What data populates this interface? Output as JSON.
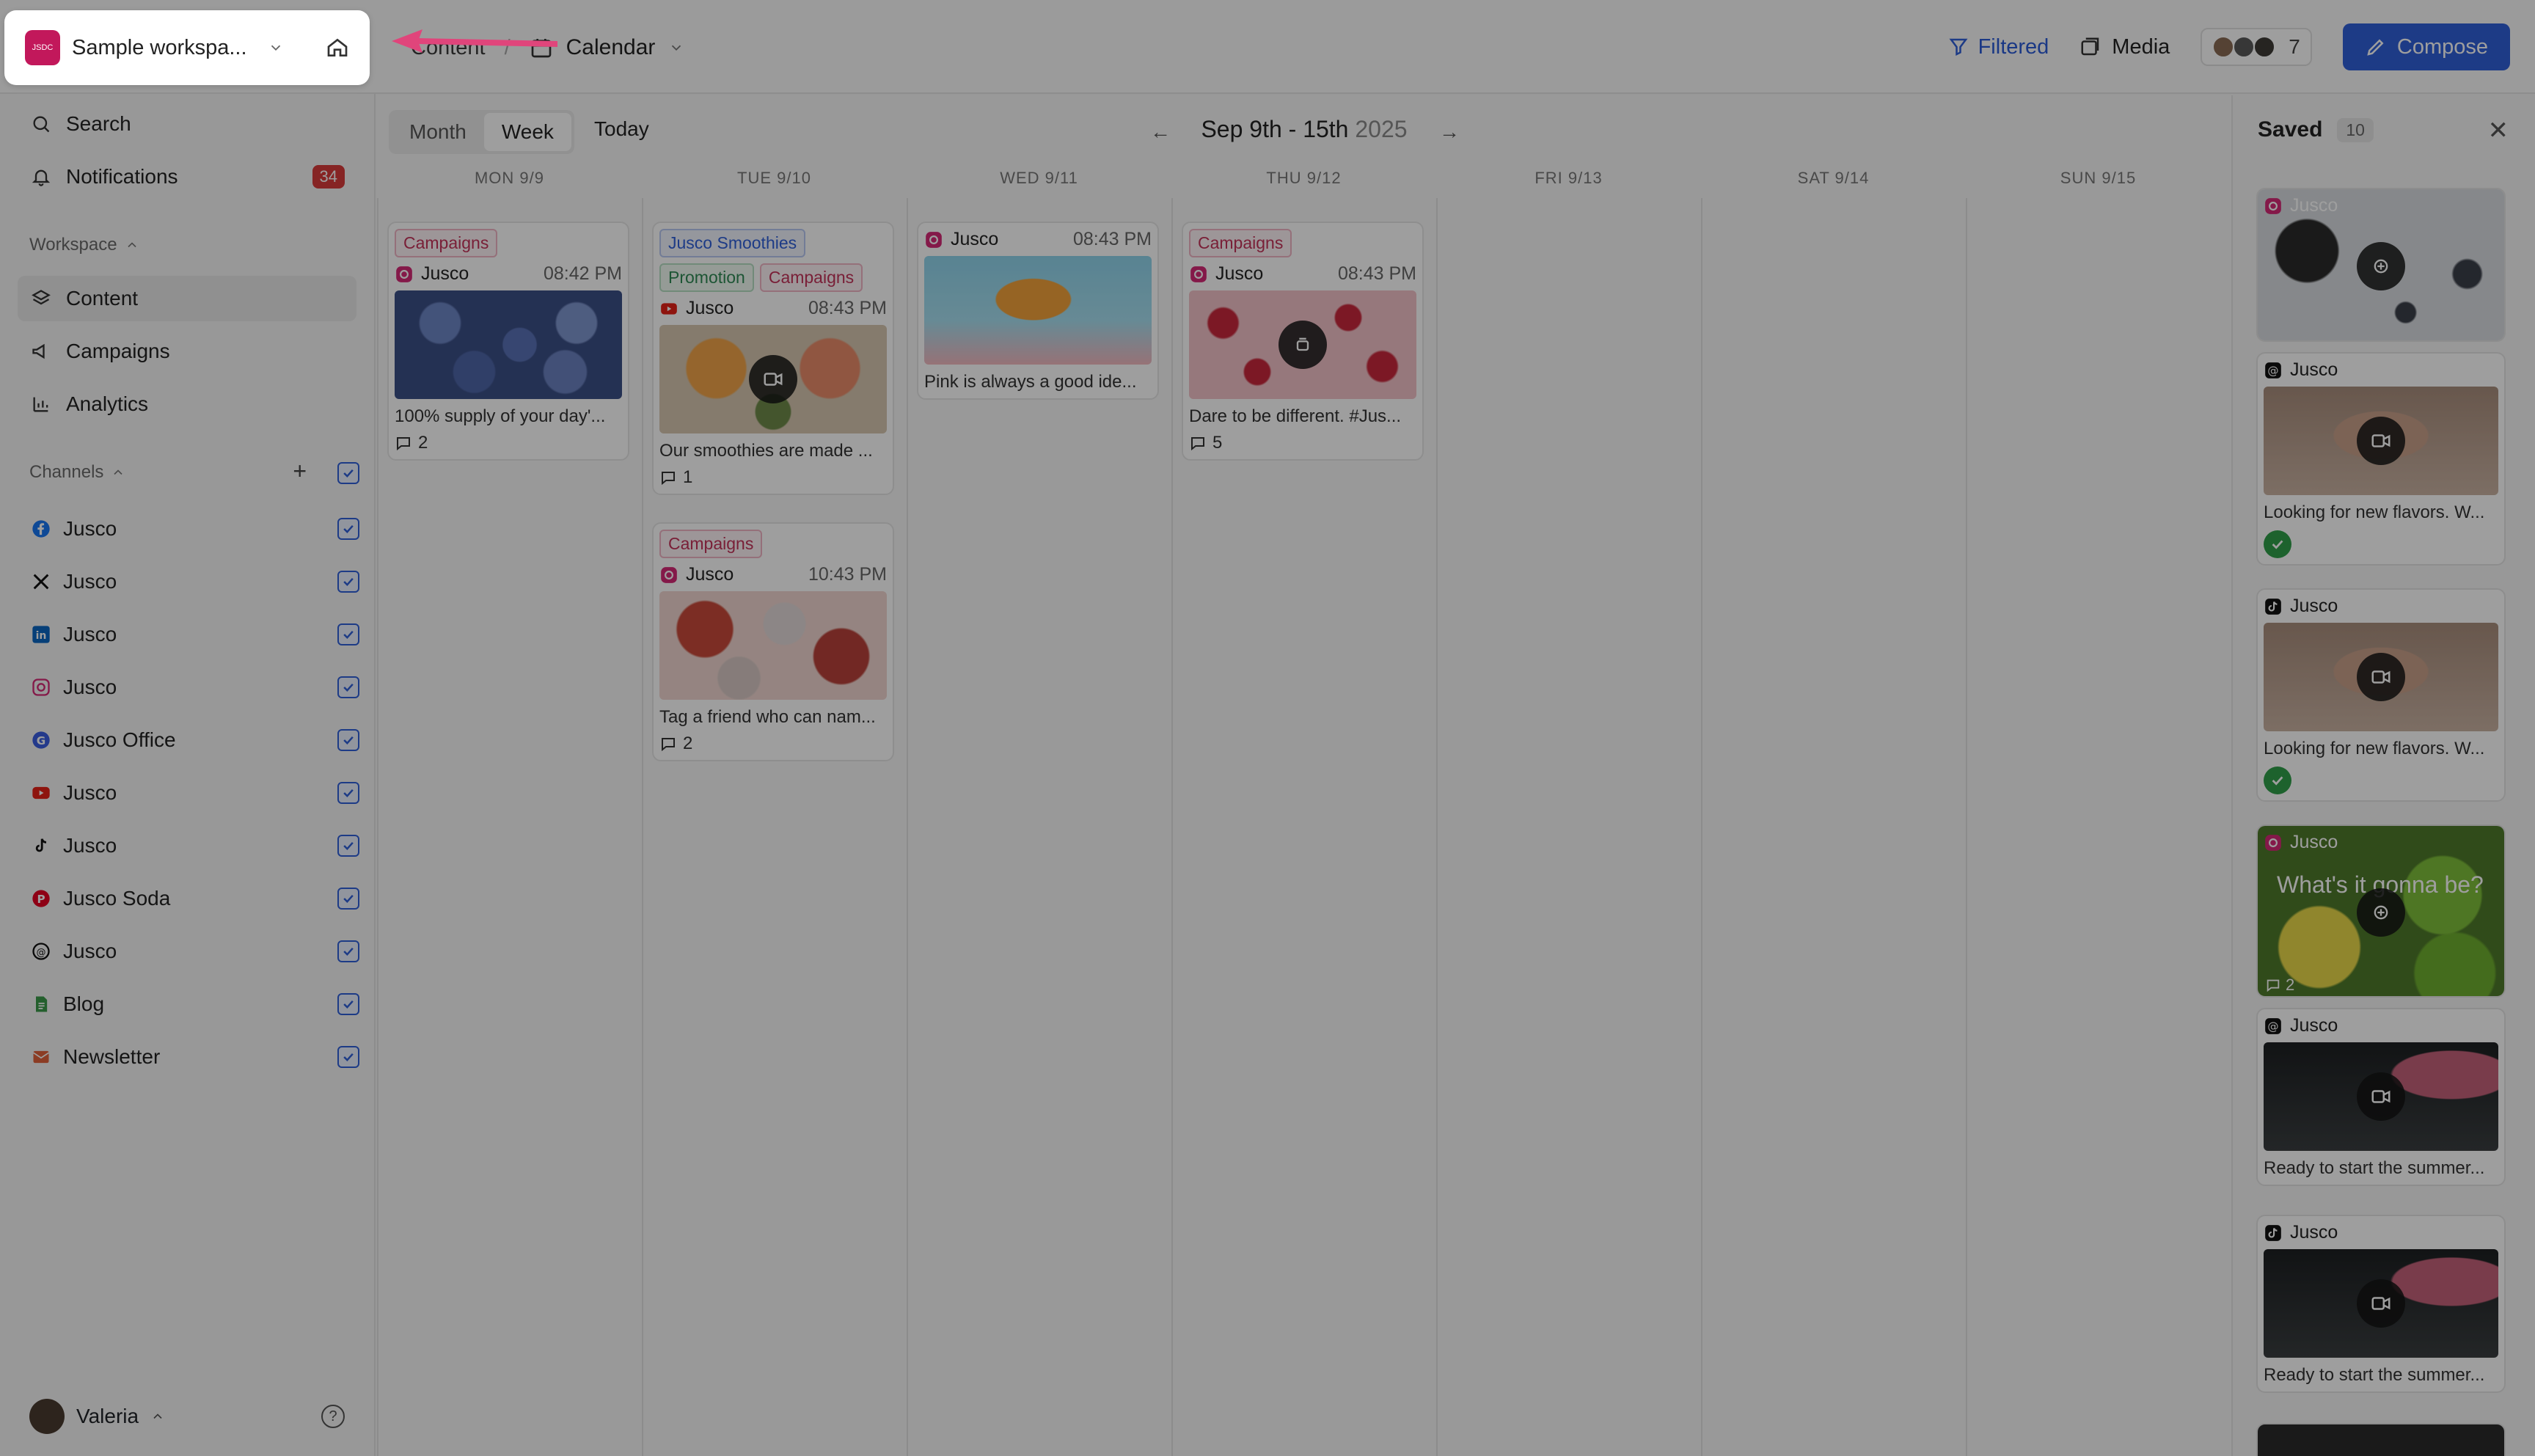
{
  "workspace": {
    "logo_text": "JSDC",
    "name": "Sample workspa..."
  },
  "breadcrumb": {
    "content": "Content",
    "separator": "/",
    "calendar": "Calendar"
  },
  "topbar": {
    "filtered": "Filtered",
    "media": "Media",
    "members_count": "7",
    "compose": "Compose"
  },
  "sidebar": {
    "search": "Search",
    "notifications": "Notifications",
    "notifications_count": "34",
    "workspace_header": "Workspace",
    "content": "Content",
    "campaigns": "Campaigns",
    "analytics": "Analytics",
    "channels_header": "Channels",
    "channels": [
      {
        "icon": "facebook-icon",
        "label": "Jusco"
      },
      {
        "icon": "x-icon",
        "label": "Jusco"
      },
      {
        "icon": "linkedin-icon",
        "label": "Jusco"
      },
      {
        "icon": "instagram-icon",
        "label": "Jusco"
      },
      {
        "icon": "google-icon",
        "label": "Jusco Office"
      },
      {
        "icon": "youtube-icon",
        "label": "Jusco"
      },
      {
        "icon": "tiktok-icon",
        "label": "Jusco"
      },
      {
        "icon": "pinterest-icon",
        "label": "Jusco Soda"
      },
      {
        "icon": "threads-icon",
        "label": "Jusco"
      },
      {
        "icon": "blog-icon",
        "label": "Blog"
      },
      {
        "icon": "newsletter-icon",
        "label": "Newsletter"
      }
    ],
    "user": "Valeria"
  },
  "calendar": {
    "view_month": "Month",
    "view_week": "Week",
    "today": "Today",
    "range": "Sep 9th - 15th",
    "range_year": "2025",
    "days": [
      "MON 9/9",
      "TUE 9/10",
      "WED 9/11",
      "THU 9/12",
      "FRI 9/13",
      "SAT 9/14",
      "SUN 9/15"
    ],
    "posts": {
      "mon1": {
        "tag": "Campaigns",
        "account": "Jusco",
        "time": "08:42 PM",
        "caption": "100% supply of your day'...",
        "comments": "2"
      },
      "tue1": {
        "tag1": "Jusco Smoothies",
        "tag2": "Promotion",
        "tag3": "Campaigns",
        "account": "Jusco",
        "time": "08:43 PM",
        "caption": "Our smoothies are made ...",
        "comments": "1"
      },
      "tue2": {
        "tag": "Campaigns",
        "account": "Jusco",
        "time": "10:43 PM",
        "caption": "Tag a friend who can nam...",
        "comments": "2"
      },
      "wed1": {
        "account": "Jusco",
        "time": "08:43 PM",
        "caption": "Pink is always a good ide..."
      },
      "thu1": {
        "tag": "Campaigns",
        "account": "Jusco",
        "time": "08:43 PM",
        "caption": "Dare to be different. #Jus...",
        "comments": "5"
      }
    }
  },
  "saved": {
    "title": "Saved",
    "count": "10",
    "items": [
      {
        "account": "Jusco",
        "caption": ""
      },
      {
        "account": "Jusco",
        "caption": "Looking for new flavors. W..."
      },
      {
        "account": "Jusco",
        "caption": "Looking for new flavors. W..."
      },
      {
        "account": "Jusco",
        "overlay": "What's it gonna be?",
        "comments": "2"
      },
      {
        "account": "Jusco",
        "caption": "Ready to start the summer..."
      },
      {
        "account": "Jusco",
        "caption": "Ready to start the summer..."
      }
    ]
  },
  "colors": {
    "accent": "#2f5fd9",
    "campaign_tag": "#c4325a",
    "badge": "#d93a3a",
    "pointer": "#e0457b"
  }
}
